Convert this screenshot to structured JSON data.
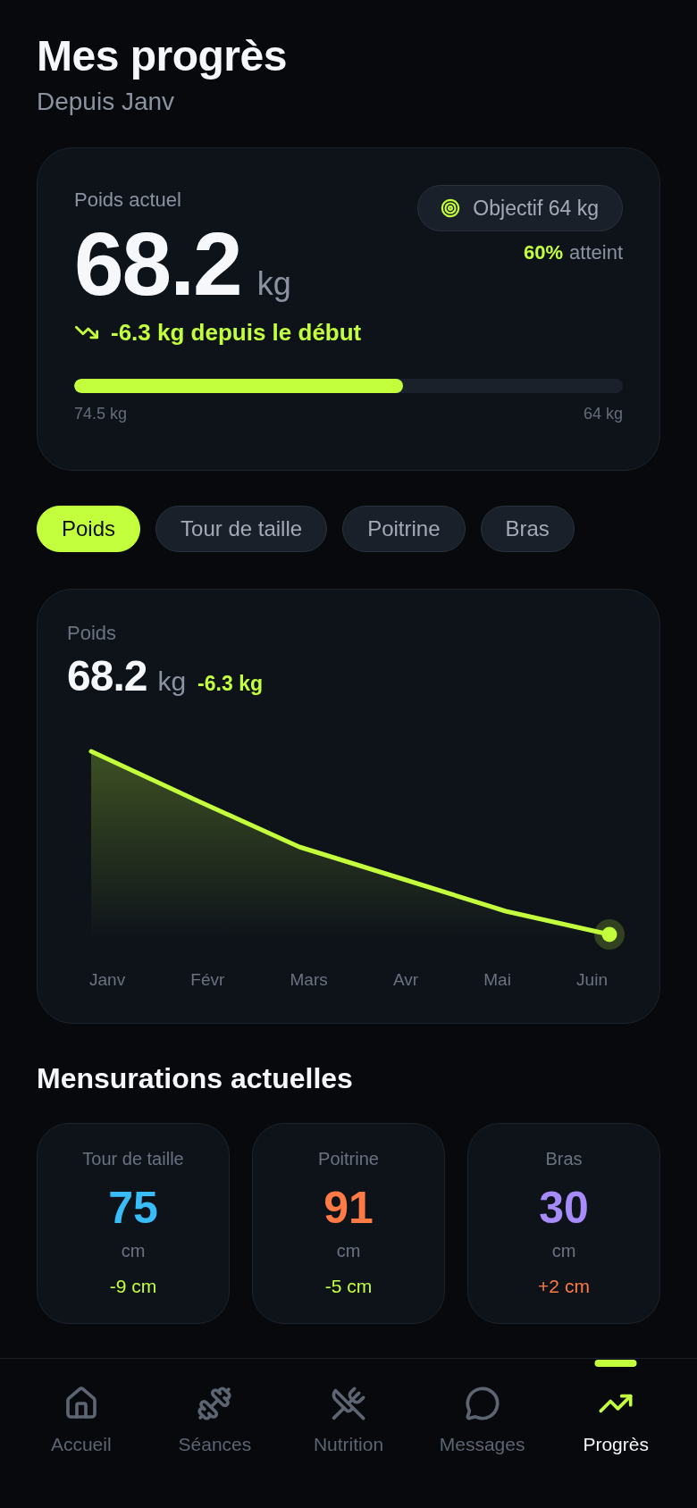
{
  "header": {
    "title": "Mes progrès",
    "subtitle": "Depuis Janv"
  },
  "weight_card": {
    "label": "Poids actuel",
    "value": "68.2",
    "unit": "kg",
    "goal": "Objectif 64 kg",
    "goal_percent": "60%",
    "goal_status": "atteint",
    "change": "-6.3 kg depuis le début",
    "progress": {
      "level": 0.6,
      "start": "74.5 kg",
      "end": "64 kg"
    }
  },
  "tabs": [
    {
      "label": "Poids",
      "selected": true
    },
    {
      "label": "Tour de taille",
      "selected": false
    },
    {
      "label": "Poitrine",
      "selected": false
    },
    {
      "label": "Bras",
      "selected": false
    }
  ],
  "chart_card": {
    "label": "Poids",
    "value": "68.2",
    "unit": "kg",
    "change": "-6.3 kg",
    "x_labels": [
      "Janv",
      "Févr",
      "Mars",
      "Avr",
      "Mai",
      "Juin"
    ]
  },
  "measurements": {
    "title": "Mensurations actuelles",
    "items": [
      {
        "label": "Tour de taille",
        "value": "75",
        "unit": "cm",
        "color": "#38bdf8",
        "change": {
          "text": "-9 cm",
          "color": "#c3ff3c"
        }
      },
      {
        "label": "Poitrine",
        "value": "91",
        "unit": "cm",
        "color": "#ff7a45",
        "change": {
          "text": "-5 cm",
          "color": "#c3ff3c"
        }
      },
      {
        "label": "Bras",
        "value": "30",
        "unit": "cm",
        "color": "#a78bfa",
        "change": {
          "text": "+2 cm",
          "color": "#ff7a45"
        }
      }
    ]
  },
  "nav": [
    {
      "label": "Accueil",
      "selected": false
    },
    {
      "label": "Séances",
      "selected": false
    },
    {
      "label": "Nutrition",
      "selected": false
    },
    {
      "label": "Messages",
      "selected": false
    },
    {
      "label": "Progrès",
      "selected": true
    }
  ]
}
